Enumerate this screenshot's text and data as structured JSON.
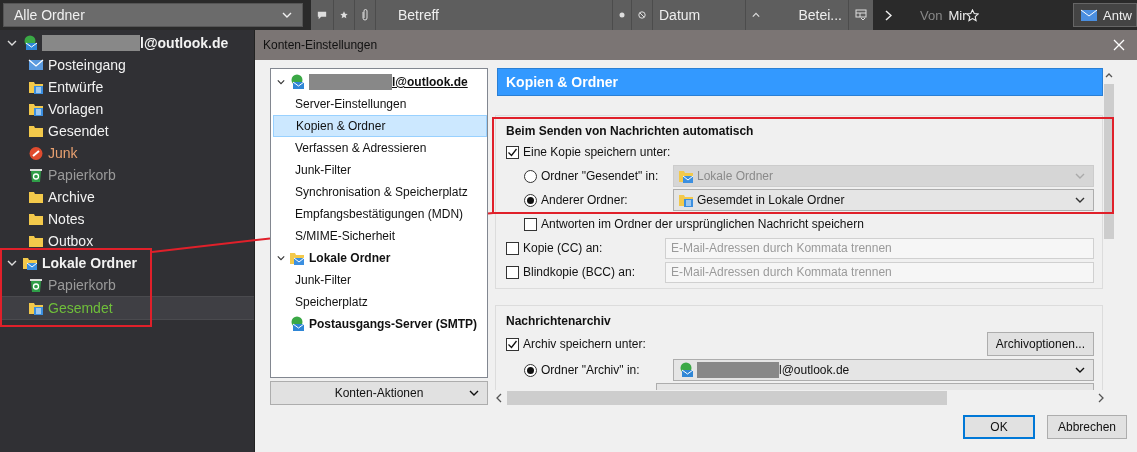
{
  "toolbar": {
    "folder_picker": "Alle Ordner",
    "subject_column": "Betreff",
    "date_column": "Datum",
    "column_3": "Betei...",
    "from_label": "Von",
    "from_value": "Mir",
    "reply_button": "Antw"
  },
  "folder_tree": [
    {
      "label": "l@outlook.de",
      "kind": "account",
      "expanded": true,
      "children": [
        {
          "label": "Posteingang",
          "kind": "inbox",
          "selected": false
        },
        {
          "label": "Entwürfe",
          "kind": "drafts",
          "selected": false
        },
        {
          "label": "Vorlagen",
          "kind": "templates",
          "selected": false
        },
        {
          "label": "Gesendet",
          "kind": "folder",
          "selected": false
        },
        {
          "label": "Junk",
          "kind": "junk",
          "selected": false
        },
        {
          "label": "Papierkorb",
          "kind": "trash",
          "selected": false
        },
        {
          "label": "Archive",
          "kind": "folder",
          "selected": false
        },
        {
          "label": "Notes",
          "kind": "folder",
          "selected": false
        },
        {
          "label": "Outbox",
          "kind": "folder",
          "selected": false
        }
      ]
    },
    {
      "label": "Lokale Ordner",
      "kind": "local",
      "expanded": true,
      "children": [
        {
          "label": "Papierkorb",
          "kind": "trash",
          "selected": false
        },
        {
          "label": "Gesemdet",
          "kind": "sent",
          "selected": true
        }
      ]
    }
  ],
  "dialog": {
    "title": "Konten-Einstellungen",
    "tree": [
      {
        "label": "l@outlook.de",
        "kind": "account",
        "expanded": true,
        "selected": false,
        "children": [
          {
            "label": "Server-Einstellungen",
            "selected": false
          },
          {
            "label": "Kopien & Ordner",
            "selected": true
          },
          {
            "label": "Verfassen & Adressieren",
            "selected": false
          },
          {
            "label": "Junk-Filter",
            "selected": false
          },
          {
            "label": "Synchronisation & Speicherplatz",
            "selected": false
          },
          {
            "label": "Empfangsbestätigungen (MDN)",
            "selected": false
          },
          {
            "label": "S/MIME-Sicherheit",
            "selected": false
          }
        ]
      },
      {
        "label": "Lokale Ordner",
        "kind": "local",
        "expanded": true,
        "selected": false,
        "children": [
          {
            "label": "Junk-Filter",
            "selected": false
          },
          {
            "label": "Speicherplatz",
            "selected": false
          }
        ]
      },
      {
        "label": "Postausgangs-Server (SMTP)",
        "kind": "smtp",
        "selected": false
      }
    ],
    "actions_button": "Konten-Aktionen",
    "panel_title": "Kopien & Ordner",
    "sending": {
      "title": "Beim Senden von Nachrichten automatisch",
      "save_copy": {
        "label": "Eine Kopie speichern unter:",
        "checked": true
      },
      "targets": [
        {
          "label": "Ordner \"Gesendet\" in:",
          "selected": false,
          "disabled": true,
          "value": "Lokale Ordner",
          "kind": "local"
        },
        {
          "label": "Anderer Ordner:",
          "selected": true,
          "disabled": false,
          "value": "Gesemdet in Lokale Ordner",
          "kind": "sent"
        }
      ],
      "reply_in_folder": {
        "label": "Antworten im Ordner der ursprünglichen Nachricht speichern",
        "checked": false
      },
      "cc": {
        "label": "Kopie (CC) an:",
        "checked": false,
        "placeholder": "E-Mail-Adressen durch Kommata trennen"
      },
      "bcc": {
        "label": "Blindkopie (BCC) an:",
        "checked": false,
        "placeholder": "E-Mail-Adressen durch Kommata trennen"
      }
    },
    "archive": {
      "title": "Nachrichtenarchiv",
      "save_archive": {
        "label": "Archiv speichern unter:",
        "checked": true
      },
      "options_button": "Archivoptionen...",
      "target": {
        "label": "Ordner \"Archiv\" in:",
        "selected": true,
        "value": "l@outlook.de",
        "kind": "account"
      }
    },
    "buttons": [
      "OK",
      "Abbrechen"
    ]
  }
}
